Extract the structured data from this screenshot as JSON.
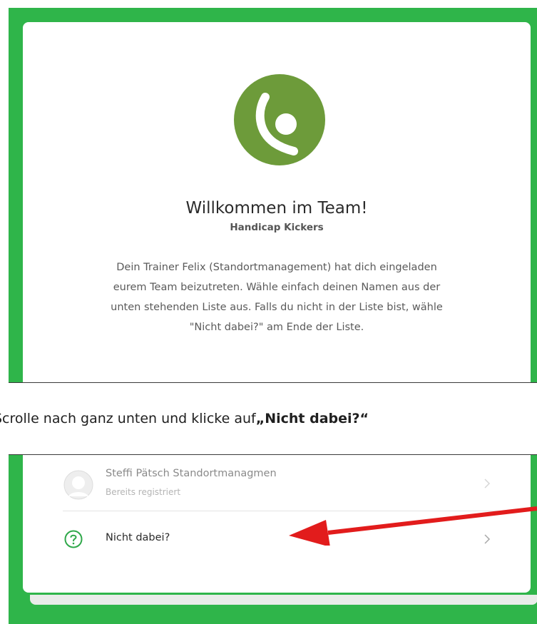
{
  "welcome": {
    "title": "Willkommen im Team!",
    "team_name": "Handicap Kickers",
    "intro_lines": [
      "Dein Trainer Felix (Standortmanagement) hat dich eingeladen",
      "eurem Team beizutreten. Wähle einfach deinen Namen aus der",
      "unten stehenden Liste aus. Falls du nicht in der Liste bist, wähle",
      "\"Nicht dabei?\" am Ende der Liste."
    ],
    "logo_icon": "team-logo-icon"
  },
  "instruction": {
    "lead": "Scrolle nach ganz unten und klicke auf ",
    "bold": "„Nicht dabei?“"
  },
  "member_list": {
    "items": [
      {
        "name": "Steffi Pätsch Standortmanagmen",
        "status": "Bereits registriert",
        "icon": "avatar-placeholder-icon"
      }
    ],
    "not_listed": {
      "label": "Nicht dabei?",
      "icon": "question-circle-icon"
    }
  },
  "colors": {
    "frame_green": "#2fb54a",
    "logo_green": "#6d9b3a",
    "question_green": "#2fa84a",
    "arrow_red": "#e21c1c"
  }
}
